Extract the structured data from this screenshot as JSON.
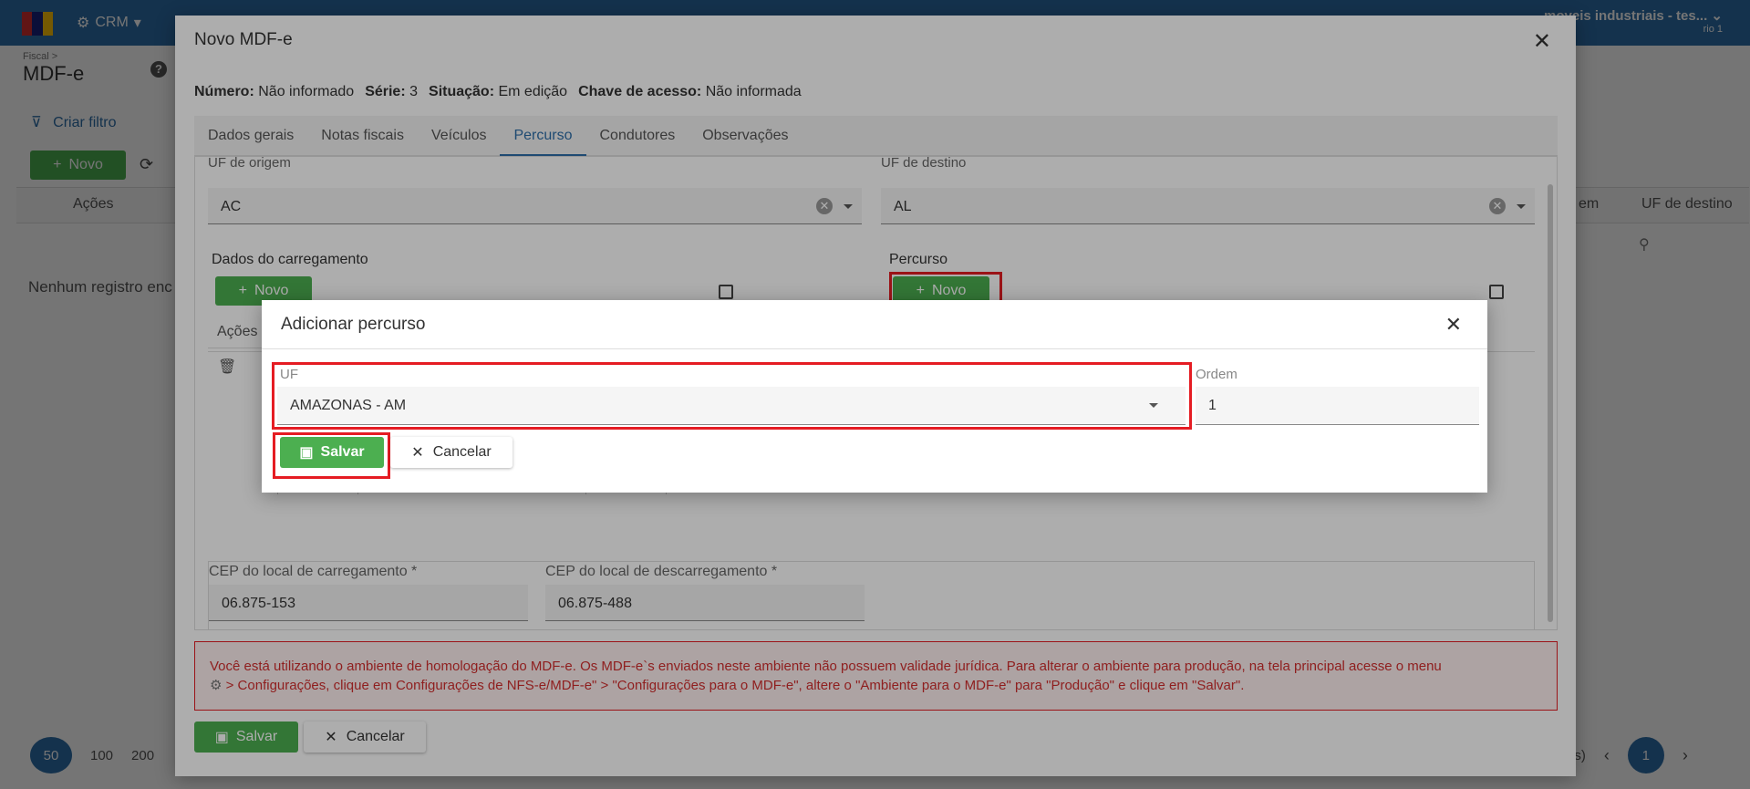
{
  "topbar": {
    "nav_crm": "CRM",
    "user_name": "moveis industriais - tes...",
    "user_sub": "rio 1"
  },
  "page": {
    "breadcrumb": "Fiscal >",
    "title": "MDF-e",
    "create_filter": "Criar filtro",
    "novo_label": "Novo",
    "col_acoes": "Ações",
    "col_uf_destino": "UF de destino",
    "col_partial": "em",
    "empty_text": "Nenhum registro enc",
    "page_sizes": [
      "50",
      "100",
      "200"
    ],
    "pager_partial": "ns)",
    "current_page": "1"
  },
  "modal": {
    "title": "Novo MDF-e",
    "info": {
      "numero_label": "Número:",
      "numero_value": "Não informado",
      "serie_label": "Série:",
      "serie_value": "3",
      "situacao_label": "Situação:",
      "situacao_value": "Em edição",
      "chave_label": "Chave de acesso:",
      "chave_value": "Não informada"
    },
    "tabs": [
      "Dados gerais",
      "Notas fiscais",
      "Veículos",
      "Percurso",
      "Condutores",
      "Observações"
    ],
    "active_tab": "Percurso",
    "uf_origem_label": "UF de origem",
    "uf_origem_value": "AC",
    "uf_destino_label": "UF de destino",
    "uf_destino_value": "AL",
    "carregamento_title": "Dados do carregamento",
    "percurso_title": "Percurso",
    "novo_label": "Novo",
    "acoes_label": "Ações",
    "cep_carregamento_label": "CEP do local de carregamento *",
    "cep_carregamento_value": "06.875-153",
    "cep_descarregamento_label": "CEP do local de descarregamento *",
    "cep_descarregamento_value": "06.875-488",
    "warning_text_1": "Você está utilizando o ambiente de homologação do MDF-e. Os MDF-e`s enviados neste ambiente não possuem validade jurídica. Para alterar o ambiente para produção, na tela principal acesse o menu",
    "warning_text_2": "> Configurações, clique em Configurações de NFS-e/MDF-e\" > \"Configurações para o MDF-e\", altere o \"Ambiente para o MDF-e\" para \"Produção\" e clique em \"Salvar\".",
    "salvar_label": "Salvar",
    "cancelar_label": "Cancelar"
  },
  "dialog": {
    "title": "Adicionar percurso",
    "uf_label": "UF",
    "uf_value": "AMAZONAS - AM",
    "ordem_label": "Ordem",
    "ordem_value": "1",
    "salvar_label": "Salvar",
    "cancelar_label": "Cancelar"
  },
  "colors": {
    "primary": "#2d6ea8",
    "success": "#4caf50",
    "highlight": "#e51c23"
  }
}
